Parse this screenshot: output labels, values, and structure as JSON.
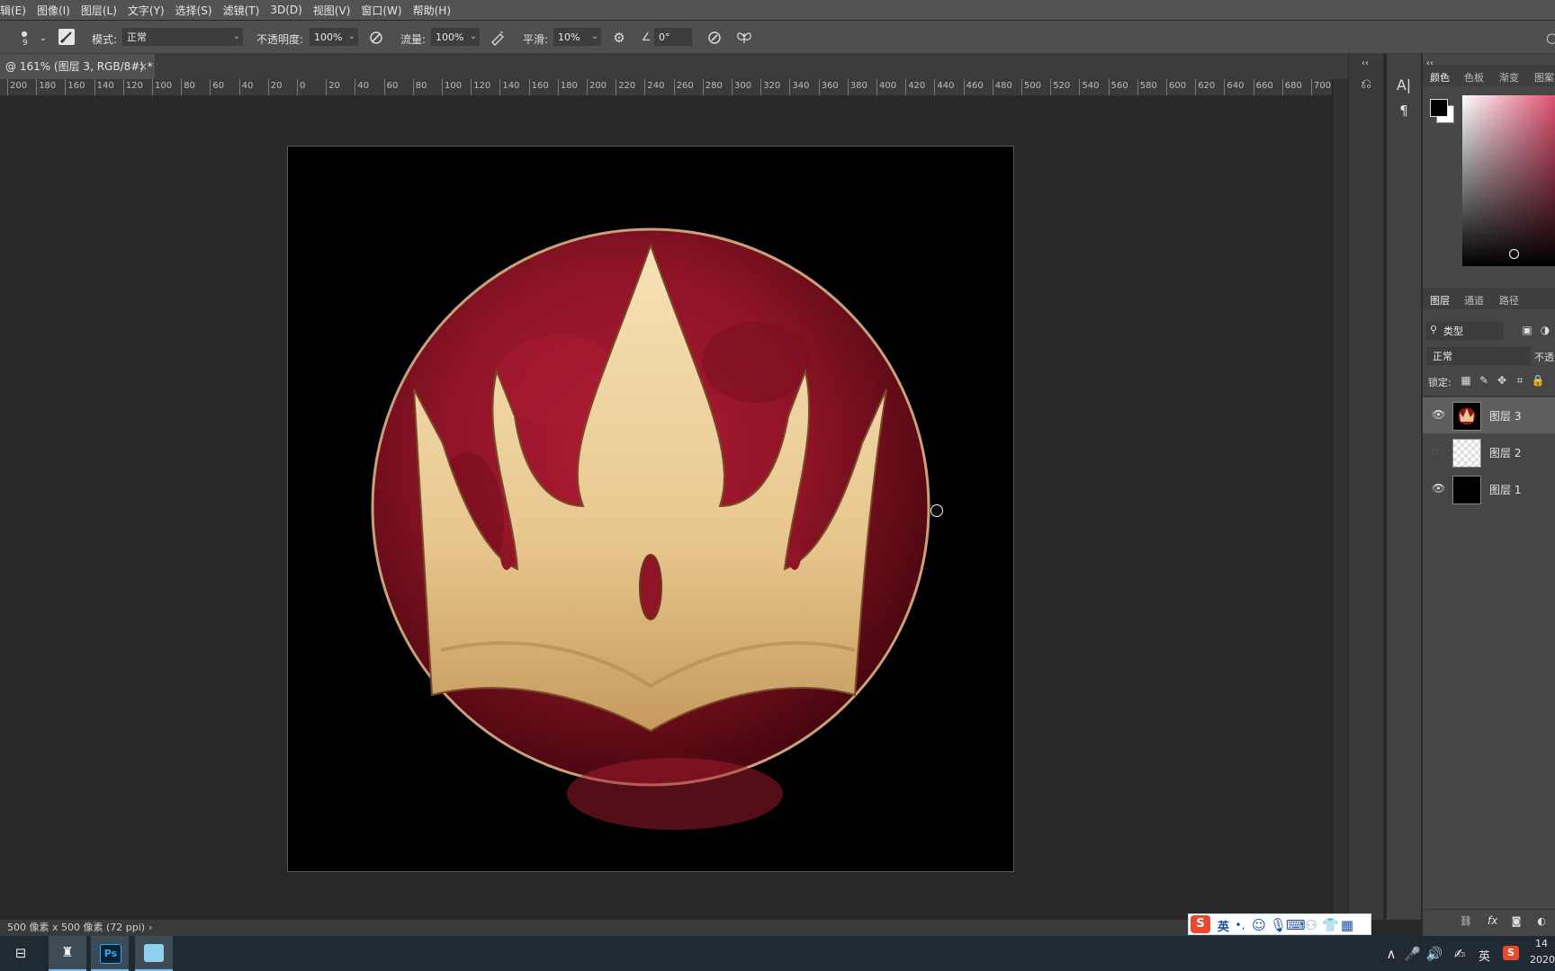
{
  "menu": [
    "辑(E)",
    "图像(I)",
    "图层(L)",
    "文字(Y)",
    "选择(S)",
    "滤镜(T)",
    "3D(D)",
    "视图(V)",
    "窗口(W)",
    "帮助(H)"
  ],
  "options": {
    "brush_size": "9",
    "mode_label": "模式:",
    "mode_value": "正常",
    "opacity_label": "不透明度:",
    "opacity_value": "100%",
    "flow_label": "流量:",
    "flow_value": "100%",
    "smooth_label": "平滑:",
    "smooth_value": "10%",
    "angle_value": "0°"
  },
  "document_tab": {
    "title": "@ 161% (图层 3, RGB/8#) *",
    "close": "×"
  },
  "ruler_labels": [
    "200",
    "180",
    "160",
    "140",
    "120",
    "100",
    "80",
    "60",
    "40",
    "20",
    "0",
    "20",
    "40",
    "60",
    "80",
    "100",
    "120",
    "140",
    "160",
    "180",
    "200",
    "220",
    "240",
    "260",
    "280",
    "300",
    "320",
    "340",
    "360",
    "380",
    "400",
    "420",
    "440",
    "460",
    "480",
    "500",
    "520",
    "540",
    "560",
    "580",
    "600",
    "620",
    "640",
    "660",
    "680",
    "700"
  ],
  "status": {
    "doc_size": "500 像素 x 500 像素 (72 ppi)",
    "arrow": "›"
  },
  "panels": {
    "color_tabs": [
      "颜色",
      "色板",
      "渐变",
      "图案"
    ],
    "layer_tabs": [
      "图层",
      "通道",
      "路径"
    ],
    "filter_label": "类型",
    "blend_mode": "正常",
    "opacity_short": "不透",
    "lock_label": "锁定:",
    "layers": [
      {
        "name": "图层 3",
        "visible": true,
        "selected": true
      },
      {
        "name": "图层 2",
        "visible": false,
        "selected": false
      },
      {
        "name": "图层 1",
        "visible": true,
        "selected": false
      }
    ],
    "footer_fx": "fx"
  },
  "taskbar": {
    "ps_label": "Ps",
    "ime_lang": "英",
    "tray_lang": "英",
    "clock_time": "14",
    "clock_date": "2020"
  },
  "colors": {
    "crown_gold": "#e8c78e",
    "ruby_red": "#8e1426",
    "accent_blue": "#7ab8e8"
  }
}
